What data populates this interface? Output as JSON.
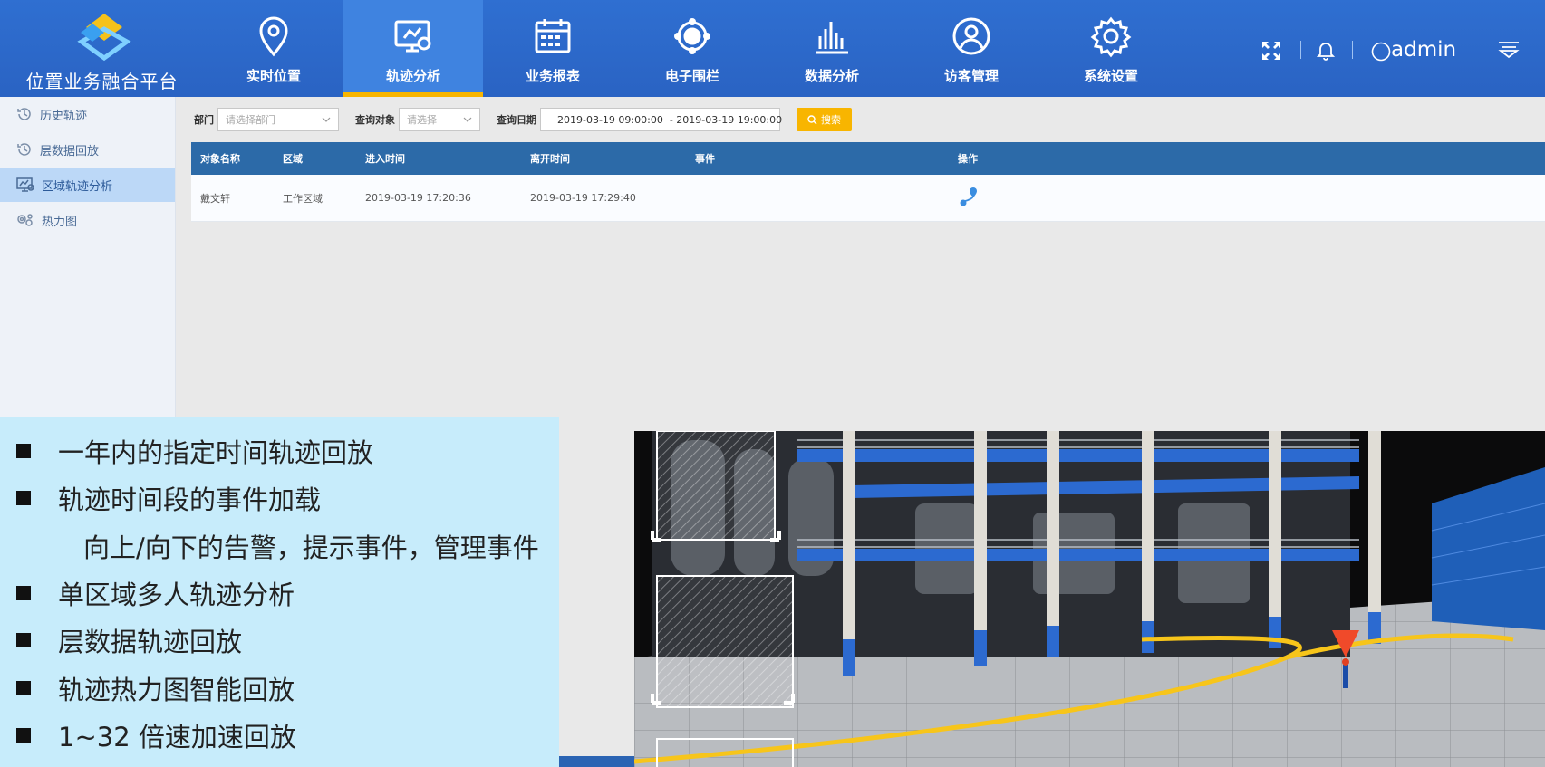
{
  "header": {
    "brand_title": "位置业务融合平台",
    "nav": [
      {
        "label": "实时位置",
        "icon": "map-pin-icon"
      },
      {
        "label": "轨迹分析",
        "icon": "monitor-track-icon",
        "active": true
      },
      {
        "label": "业务报表",
        "icon": "calendar-icon"
      },
      {
        "label": "电子围栏",
        "icon": "fence-icon"
      },
      {
        "label": "数据分析",
        "icon": "bar-chart-icon"
      },
      {
        "label": "访客管理",
        "icon": "user-icon"
      },
      {
        "label": "系统设置",
        "icon": "gear-icon"
      }
    ],
    "user": "admin"
  },
  "sidebar": {
    "items": [
      {
        "label": "历史轨迹",
        "icon": "history-icon"
      },
      {
        "label": "层数据回放",
        "icon": "history-icon"
      },
      {
        "label": "区域轨迹分析",
        "icon": "monitor-icon",
        "active": true
      },
      {
        "label": "热力图",
        "icon": "heatmap-icon"
      }
    ]
  },
  "filter": {
    "dept_label": "部门",
    "dept_placeholder": "请选择部门",
    "object_label": "查询对象",
    "object_placeholder": "请选择",
    "date_label": "查询日期",
    "date_value": "2019-03-19 09:00:00  - 2019-03-19 19:00:00",
    "search_label": "搜索"
  },
  "table": {
    "columns": [
      "对象名称",
      "区域",
      "进入时间",
      "离开时间",
      "事件",
      "操作"
    ],
    "rows": [
      {
        "name": "戴文轩",
        "area": "工作区域",
        "enter": "2019-03-19 17:20:36",
        "leave": "2019-03-19 17:29:40",
        "event": ""
      }
    ]
  },
  "features": {
    "items": [
      "一年内的指定时间轨迹回放",
      "轨迹时间段的事件加载",
      "单区域多人轨迹分析",
      "层数据轨迹回放",
      "轨迹热力图智能回放",
      "1~32 倍速加速回放"
    ],
    "sub_item": "向上/向下的告警，提示事件，管理事件"
  },
  "colors": {
    "header_bg": "#2f6fd1",
    "active_nav_bg": "#3f83e0",
    "accent": "#f8b500",
    "table_header": "#2c6aa8",
    "feature_bg": "#c7ecfb"
  }
}
